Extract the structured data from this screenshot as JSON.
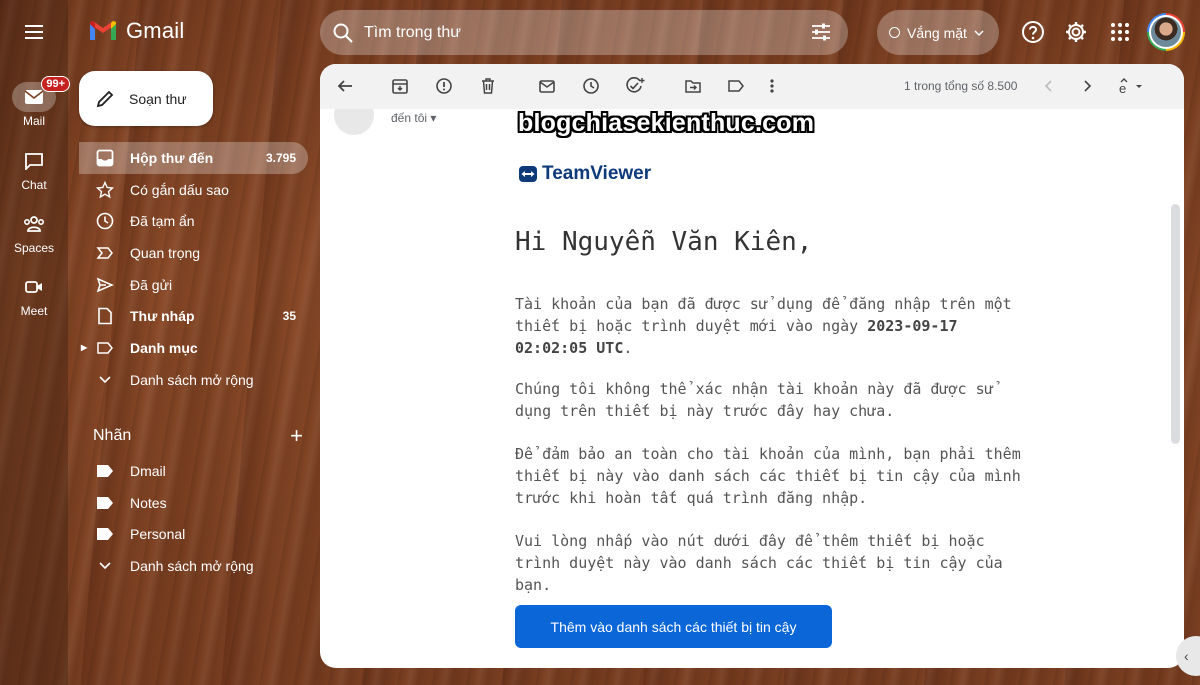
{
  "app": {
    "name": "Gmail"
  },
  "rail": [
    {
      "label": "Mail",
      "badge": "99+"
    },
    {
      "label": "Chat"
    },
    {
      "label": "Spaces"
    },
    {
      "label": "Meet"
    }
  ],
  "compose_label": "Soạn thư",
  "search": {
    "placeholder": "Tìm trong thư"
  },
  "status": {
    "label": "Vắng mặt"
  },
  "nav": [
    {
      "label": "Hộp thư đến",
      "count": "3.795",
      "icon": "inbox-icon"
    },
    {
      "label": "Có gắn dấu sao",
      "icon": "star-icon"
    },
    {
      "label": "Đã tạm ẩn",
      "icon": "clock-icon"
    },
    {
      "label": "Quan trọng",
      "icon": "important-icon"
    },
    {
      "label": "Đã gửi",
      "icon": "send-icon"
    },
    {
      "label": "Thư nháp",
      "count": "35",
      "icon": "draft-icon"
    },
    {
      "label": "Danh mục",
      "icon": "label-icon"
    },
    {
      "label": "Danh sách mở rộng",
      "icon": "chevron-down-icon"
    }
  ],
  "labels_section": {
    "title": "Nhãn"
  },
  "labels": [
    {
      "label": "Dmail"
    },
    {
      "label": "Notes"
    },
    {
      "label": "Personal"
    },
    {
      "label": "Danh sách mở rộng"
    }
  ],
  "toolbar": {
    "page_info": "1 trong tổng số 8.500"
  },
  "email": {
    "to_me": "đến tôi",
    "watermark": "blogchiasekienthuc.com",
    "brand": "TeamViewer",
    "greeting": "Hi Nguyễn Văn Kiên,",
    "p1_a": "Tài khoản của bạn đã được sử dụng để đăng nhập trên một thiết bị hoặc trình duyệt mới vào ngày ",
    "p1_date": "2023-09-17 02:02:05 UTC",
    "p1_end": ".",
    "p2": "Chúng tôi không thể xác nhận tài khoản này đã được sử dụng trên thiết bị này trước đây hay chưa.",
    "p3": "Để đảm bảo an toàn cho tài khoản của mình, bạn phải thêm thiết bị này vào danh sách các thiết bị tin cậy của mình trước khi hoàn tất quá trình đăng nhập.",
    "p4": "Vui lòng nhấp vào nút dưới đây để thêm thiết bị hoặc trình duyệt này vào danh sách các thiết bị tin cậy của bạn.",
    "cta": "Thêm vào danh sách các thiết bị tin cậy"
  },
  "colors": {
    "accent_button": "#0b66d8",
    "badge": "#c5221f",
    "teamviewer": "#0e3a7a"
  }
}
